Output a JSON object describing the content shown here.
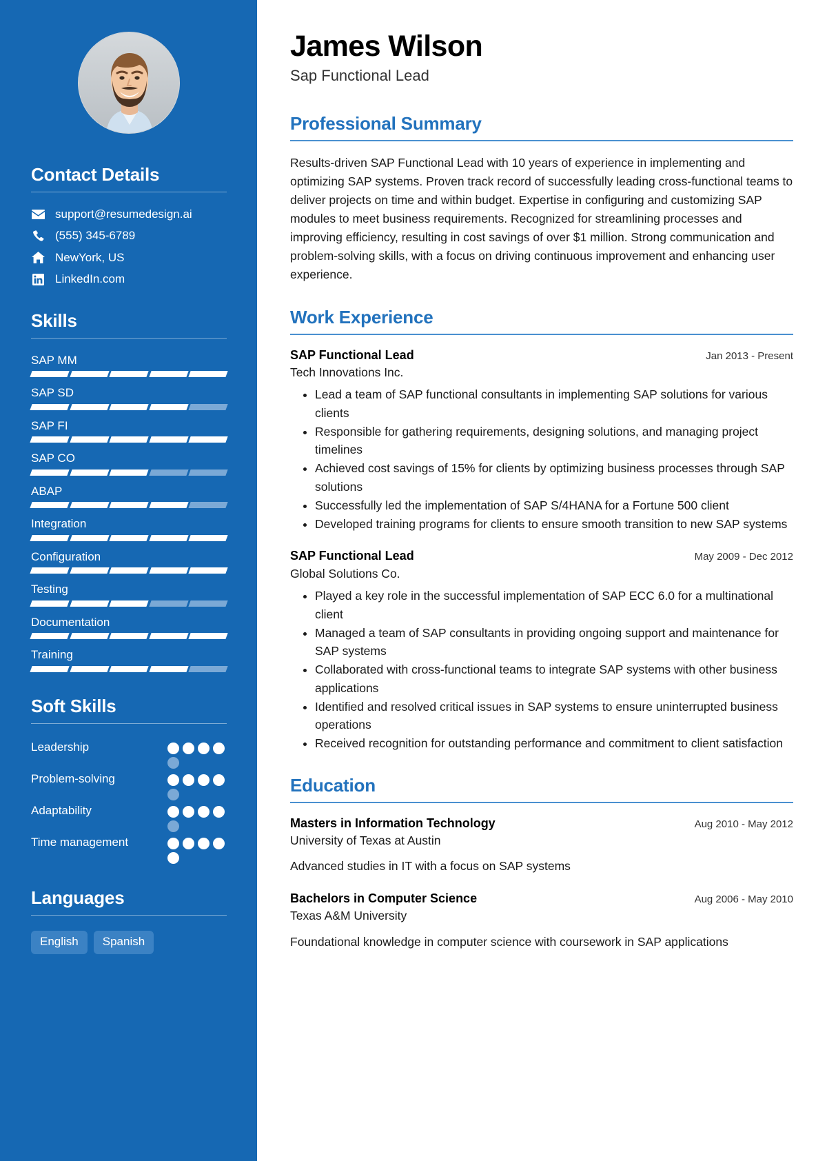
{
  "sidebar": {
    "avatar": {
      "alt": "profile-photo"
    },
    "contact": {
      "heading": "Contact Details",
      "items": [
        {
          "icon": "email-icon",
          "text": "support@resumedesign.ai"
        },
        {
          "icon": "phone-icon",
          "text": "(555) 345-6789"
        },
        {
          "icon": "home-icon",
          "text": "NewYork, US"
        },
        {
          "icon": "linkedin-icon",
          "text": "LinkedIn.com"
        }
      ]
    },
    "skills": {
      "heading": "Skills",
      "segments": 5,
      "items": [
        {
          "name": "SAP MM",
          "filled": 5
        },
        {
          "name": "SAP SD",
          "filled": 4
        },
        {
          "name": "SAP FI",
          "filled": 5
        },
        {
          "name": "SAP CO",
          "filled": 3
        },
        {
          "name": "ABAP",
          "filled": 4
        },
        {
          "name": "Integration",
          "filled": 5
        },
        {
          "name": "Configuration",
          "filled": 5
        },
        {
          "name": "Testing",
          "filled": 3
        },
        {
          "name": "Documentation",
          "filled": 5
        },
        {
          "name": "Training",
          "filled": 4
        }
      ]
    },
    "soft_skills": {
      "heading": "Soft Skills",
      "total_dots": 5,
      "items": [
        {
          "name": "Leadership",
          "filled": 4
        },
        {
          "name": "Problem-solving",
          "filled": 4
        },
        {
          "name": "Adaptability",
          "filled": 4
        },
        {
          "name": "Time management",
          "filled": 5
        }
      ]
    },
    "languages": {
      "heading": "Languages",
      "items": [
        "English",
        "Spanish"
      ]
    }
  },
  "main": {
    "name": "James Wilson",
    "role": "Sap Functional Lead",
    "summary": {
      "heading": "Professional Summary",
      "text": "Results-driven SAP Functional Lead with 10 years of experience in implementing and optimizing SAP systems. Proven track record of successfully leading cross-functional teams to deliver projects on time and within budget. Expertise in configuring and customizing SAP modules to meet business requirements. Recognized for streamlining processes and improving efficiency, resulting in cost savings of over $1 million. Strong communication and problem-solving skills, with a focus on driving continuous improvement and enhancing user experience."
    },
    "work": {
      "heading": "Work Experience",
      "entries": [
        {
          "title": "SAP Functional Lead",
          "date": "Jan 2013 - Present",
          "org": "Tech Innovations Inc.",
          "bullets": [
            "Lead a team of SAP functional consultants in implementing SAP solutions for various clients",
            "Responsible for gathering requirements, designing solutions, and managing project timelines",
            "Achieved cost savings of 15% for clients by optimizing business processes through SAP solutions",
            "Successfully led the implementation of SAP S/4HANA for a Fortune 500 client",
            "Developed training programs for clients to ensure smooth transition to new SAP systems"
          ]
        },
        {
          "title": "SAP Functional Lead",
          "date": "May 2009 - Dec 2012",
          "org": "Global Solutions Co.",
          "bullets": [
            "Played a key role in the successful implementation of SAP ECC 6.0 for a multinational client",
            "Managed a team of SAP consultants in providing ongoing support and maintenance for SAP systems",
            "Collaborated with cross-functional teams to integrate SAP systems with other business applications",
            "Identified and resolved critical issues in SAP systems to ensure uninterrupted business operations",
            "Received recognition for outstanding performance and commitment to client satisfaction"
          ]
        }
      ]
    },
    "education": {
      "heading": "Education",
      "entries": [
        {
          "title": "Masters in Information Technology",
          "date": "Aug 2010 - May 2012",
          "org": "University of Texas at Austin",
          "desc": "Advanced studies in IT with a focus on SAP systems"
        },
        {
          "title": "Bachelors in Computer Science",
          "date": "Aug 2006 - May 2010",
          "org": "Texas A&M University",
          "desc": "Foundational knowledge in computer science with coursework in SAP applications"
        }
      ]
    }
  },
  "colors": {
    "sidebar_bg": "#1668b3",
    "accent": "#2272bd",
    "rule": "#4a90d0",
    "bar_on": "#ffffff",
    "bar_off": "#7ba9d6",
    "pill_bg": "#3b82c4"
  }
}
